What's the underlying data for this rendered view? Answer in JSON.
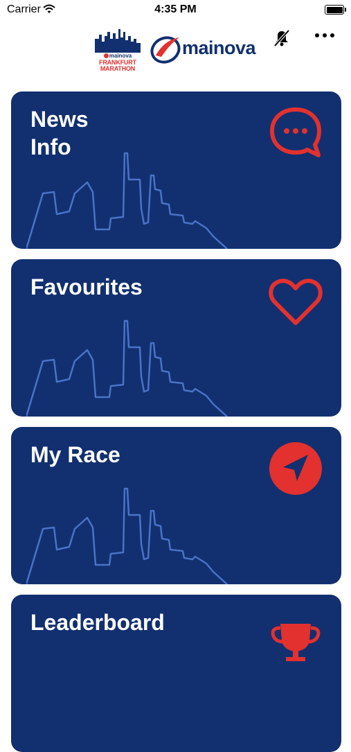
{
  "status_bar": {
    "carrier": "Carrier",
    "time": "4:35 PM"
  },
  "header": {
    "marathon_logo": {
      "brand": "mainova",
      "line1": "FRANKFURT",
      "line2": "MARATHON"
    },
    "sponsor_logo": "mainova",
    "icons": [
      "mute-icon",
      "more-icon"
    ]
  },
  "tiles": [
    {
      "title_line1": "News",
      "title_line2": "Info",
      "icon": "chat-bubble-icon"
    },
    {
      "title_line1": "Favourites",
      "icon": "heart-icon"
    },
    {
      "title_line1": "My Race",
      "icon": "navigation-arrow-icon"
    },
    {
      "title_line1": "Leaderboard",
      "icon": "trophy-icon"
    }
  ],
  "colors": {
    "tile_background": "#12306f",
    "accent_red": "#e2312f",
    "skyline_line": "#4a72c7",
    "text_white": "#ffffff"
  }
}
